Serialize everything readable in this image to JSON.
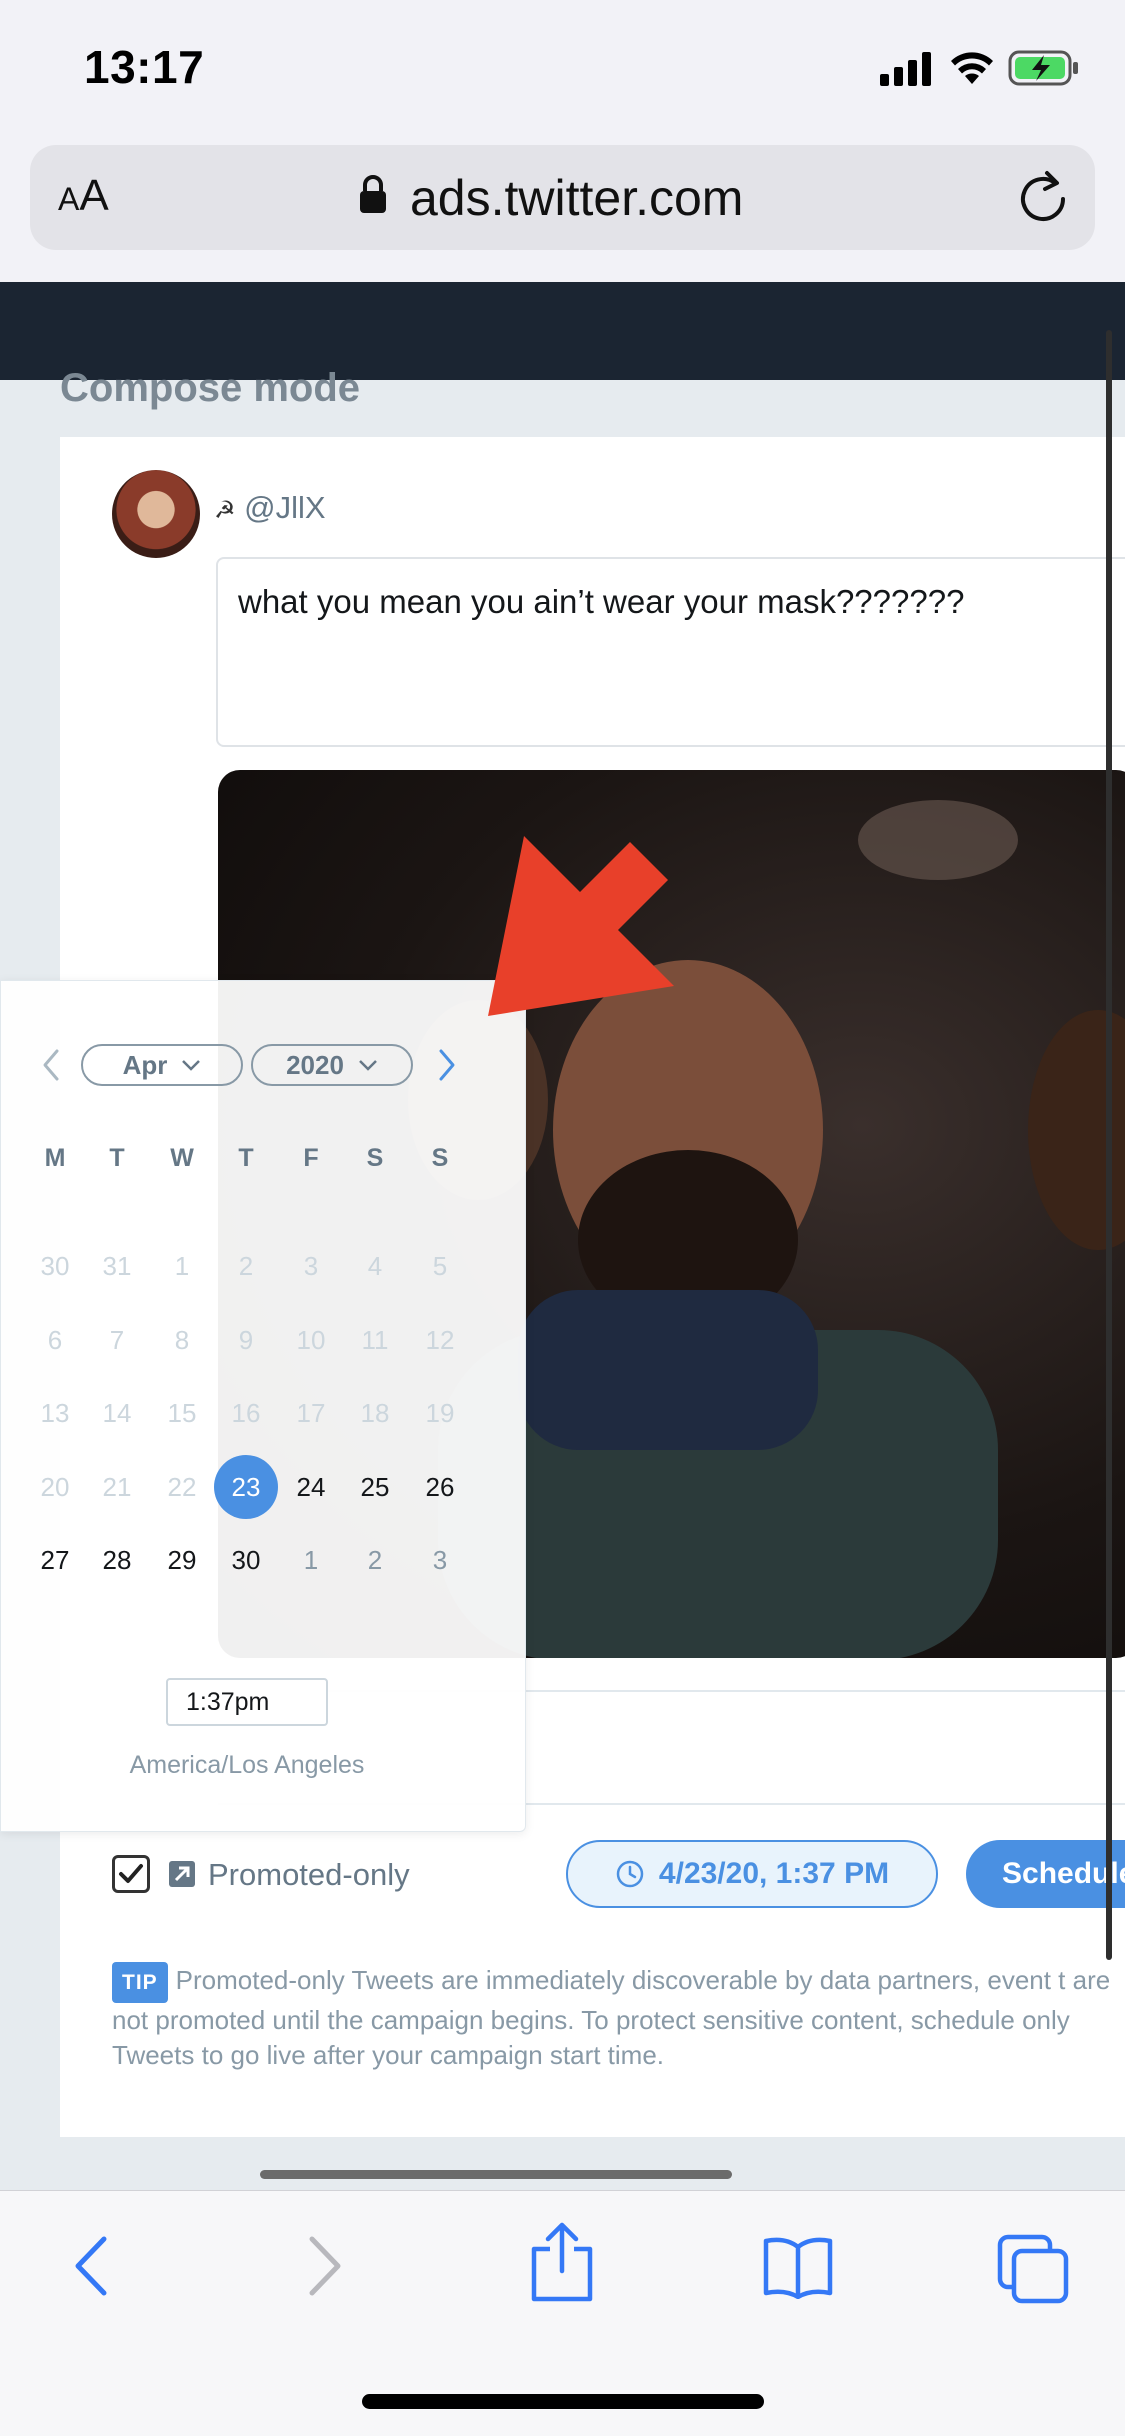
{
  "status_bar": {
    "time": "13:17",
    "signal_icon": "cellular-signal-icon",
    "wifi_icon": "wifi-icon",
    "battery_icon": "battery-charging-icon"
  },
  "browser": {
    "text_size_button": {
      "small": "A",
      "large": "A"
    },
    "url": "ads.twitter.com",
    "lock_icon": "lock-icon",
    "reload_icon": "reload-icon"
  },
  "page": {
    "title": "Compose mode"
  },
  "compose": {
    "author_glyph": "☭",
    "handle": "@JllX",
    "tweet_text": "what you mean you ain’t wear your mask???????"
  },
  "calendar": {
    "month": "Apr",
    "year": "2020",
    "weekdays": [
      "M",
      "T",
      "W",
      "T",
      "F",
      "S",
      "S"
    ],
    "weeks": [
      [
        "30",
        "31",
        "1",
        "2",
        "3",
        "4",
        "5"
      ],
      [
        "6",
        "7",
        "8",
        "9",
        "10",
        "11",
        "12"
      ],
      [
        "13",
        "14",
        "15",
        "16",
        "17",
        "18",
        "19"
      ],
      [
        "20",
        "21",
        "22",
        "23",
        "24",
        "25",
        "26"
      ],
      [
        "27",
        "28",
        "29",
        "30",
        "1",
        "2",
        "3"
      ]
    ],
    "selected_day": "23",
    "time_value": "1:37pm",
    "timezone": "America/Los Angeles"
  },
  "footer_controls": {
    "promoted_only_label": "Promoted-only",
    "promoted_checked": true,
    "schedule_time": "4/23/20, 1:37 PM",
    "schedule_button": "Schedule"
  },
  "tip": {
    "badge": "TIP",
    "text": "Promoted-only Tweets are immediately discoverable by data partners, event t are not promoted until the campaign begins. To protect sensitive content, schedule only Tweets to go live after your campaign start time."
  },
  "colors": {
    "accent": "#4a90e2",
    "nav_dark": "#1b2532",
    "arrow_red": "#e8402a"
  }
}
